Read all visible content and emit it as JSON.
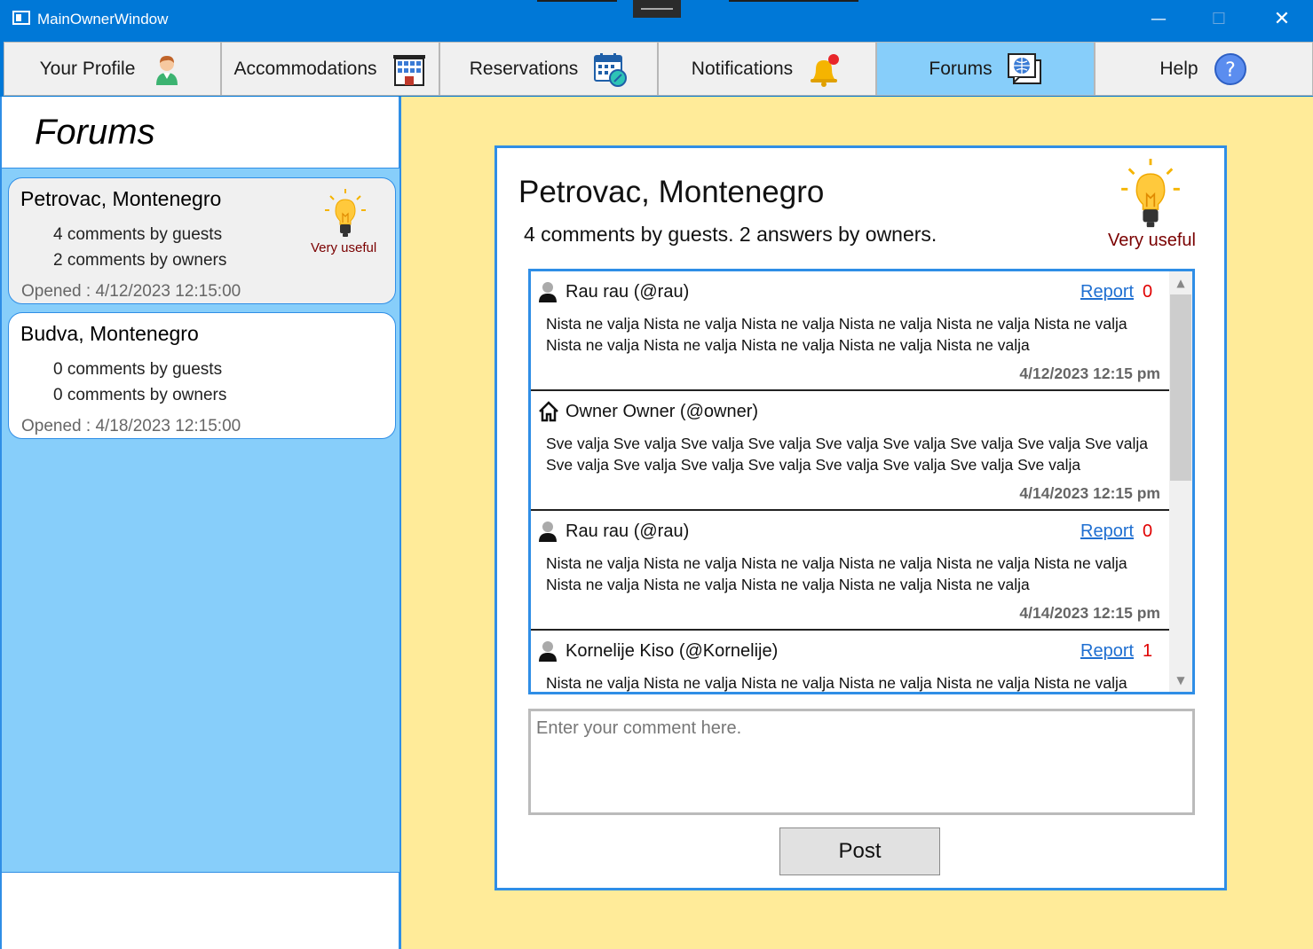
{
  "window": {
    "title": "MainOwnerWindow",
    "minimize": "—",
    "maximize": "☐",
    "close": "✕"
  },
  "nav": {
    "tabs": [
      {
        "label": "Your Profile",
        "icon": "person-icon"
      },
      {
        "label": "Accommodations",
        "icon": "building-icon"
      },
      {
        "label": "Reservations",
        "icon": "calendar-icon"
      },
      {
        "label": "Notifications",
        "icon": "bell-icon"
      },
      {
        "label": "Forums",
        "icon": "forum-icon",
        "active": true
      },
      {
        "label": "Help",
        "icon": "help-icon"
      }
    ]
  },
  "sidebar": {
    "heading": "Forums",
    "forums": [
      {
        "title": "Petrovac, Montenegro",
        "guest_comments": "4 comments by guests",
        "owner_comments": "2 comments by owners",
        "opened": "Opened : 4/12/2023 12:15:00",
        "badge": "Very useful",
        "selected": true
      },
      {
        "title": "Budva, Montenegro",
        "guest_comments": "0 comments by guests",
        "owner_comments": "0 comments by owners",
        "opened": "Opened : 4/18/2023 12:15:00",
        "selected": false
      }
    ]
  },
  "detail": {
    "title": "Petrovac, Montenegro",
    "subtitle": "4 comments by guests. 2 answers by owners.",
    "badge": "Very useful",
    "comments": [
      {
        "author": "Rau rau (@rau)",
        "role": "guest",
        "report_label": "Report",
        "report_count": "0",
        "text": "Nista ne valja Nista ne valja Nista ne valja Nista ne valja Nista ne valja Nista ne valja Nista ne valja Nista ne valja Nista ne valja Nista ne valja Nista ne valja",
        "date": "4/12/2023 12:15 pm"
      },
      {
        "author": "Owner Owner (@owner)",
        "role": "owner",
        "text": "Sve valja Sve valja Sve valja Sve valja Sve valja Sve valja Sve valja Sve valja Sve valja Sve valja Sve valja Sve valja Sve valja Sve valja Sve valja Sve valja Sve valja",
        "date": "4/14/2023 12:15 pm"
      },
      {
        "author": "Rau rau (@rau)",
        "role": "guest",
        "report_label": "Report",
        "report_count": "0",
        "text": "Nista ne valja Nista ne valja Nista ne valja Nista ne valja Nista ne valja Nista ne valja Nista ne valja Nista ne valja Nista ne valja Nista ne valja Nista ne valja",
        "date": "4/14/2023 12:15 pm"
      },
      {
        "author": "Kornelije Kiso (@Kornelije)",
        "role": "guest",
        "report_label": "Report",
        "report_count": "1",
        "text": "Nista ne valja Nista ne valja Nista ne valja Nista ne valja Nista ne valja Nista ne valja",
        "date": ""
      }
    ],
    "comment_placeholder": "Enter your comment here.",
    "post_label": "Post"
  }
}
